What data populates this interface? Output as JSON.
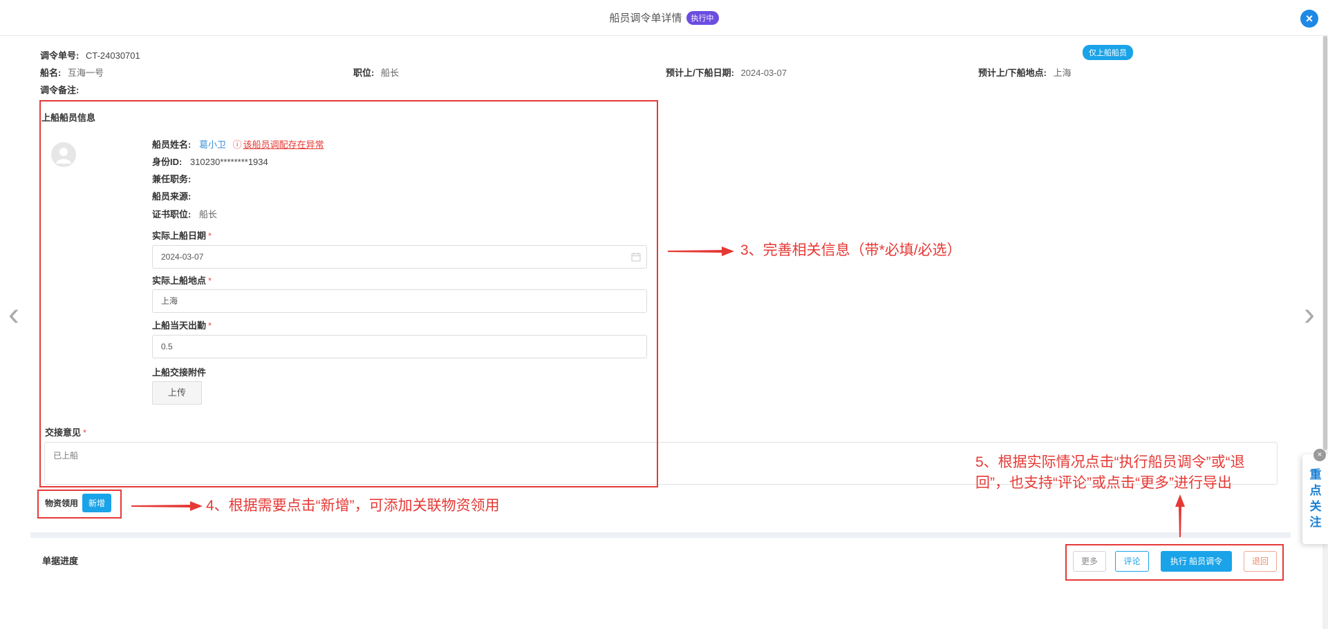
{
  "header": {
    "title": "船员调令单详情",
    "status_badge": "执行中",
    "close_icon": "×"
  },
  "order": {
    "no_label": "调令单号:",
    "no_value": "CT-24030701",
    "tag": "仅上船船员",
    "ship_label": "船名:",
    "ship_value": "互海一号",
    "position_label": "职位:",
    "position_value": "船长",
    "date_label": "预计上/下船日期:",
    "date_value": "2024-03-07",
    "place_label": "预计上/下船地点:",
    "place_value": "上海",
    "remark_label": "调令备注:"
  },
  "boarding": {
    "section_title": "上船船员信息",
    "name_label": "船员姓名:",
    "name_value": "葛小卫",
    "warning": "该船员调配存在异常",
    "id_label": "身份ID:",
    "id_value": "310230********1934",
    "concurrent_label": "兼任职务:",
    "source_label": "船员来源:",
    "cert_label": "证书职位:",
    "cert_value": "船长",
    "actual_date_label": "实际上船日期",
    "actual_date_value": "2024-03-07",
    "actual_place_label": "实际上船地点",
    "actual_place_value": "上海",
    "attendance_label": "上船当天出勤",
    "attendance_value": "0.5",
    "attachment_label": "上船交接附件",
    "upload_label": "上传",
    "required_mark": "*"
  },
  "handover": {
    "label": "交接意见",
    "value": "已上船"
  },
  "materials": {
    "label": "物资领用",
    "add_label": "新增"
  },
  "progress": {
    "label": "单据进度"
  },
  "actions": {
    "more": "更多",
    "comment": "评论",
    "execute": "执行 船员调令",
    "return": "退回"
  },
  "focus": {
    "label_chars": [
      "重",
      "点",
      "关",
      "注"
    ],
    "close": "×"
  },
  "annotations": {
    "step3": "3、完善相关信息（带*必填/必选）",
    "step4": "4、根据需要点击“新增”，可添加关联物资领用",
    "step5_line1": "5、根据实际情况点击“执行船员调令”或“退",
    "step5_line2": "回”，也支持“评论”或点击“更多”进行导出"
  },
  "colors": {
    "accent": "#1aa3e8",
    "badge_purple": "#6c4de0",
    "annotation_red": "#e53935",
    "return_orange": "#f08a6a"
  }
}
